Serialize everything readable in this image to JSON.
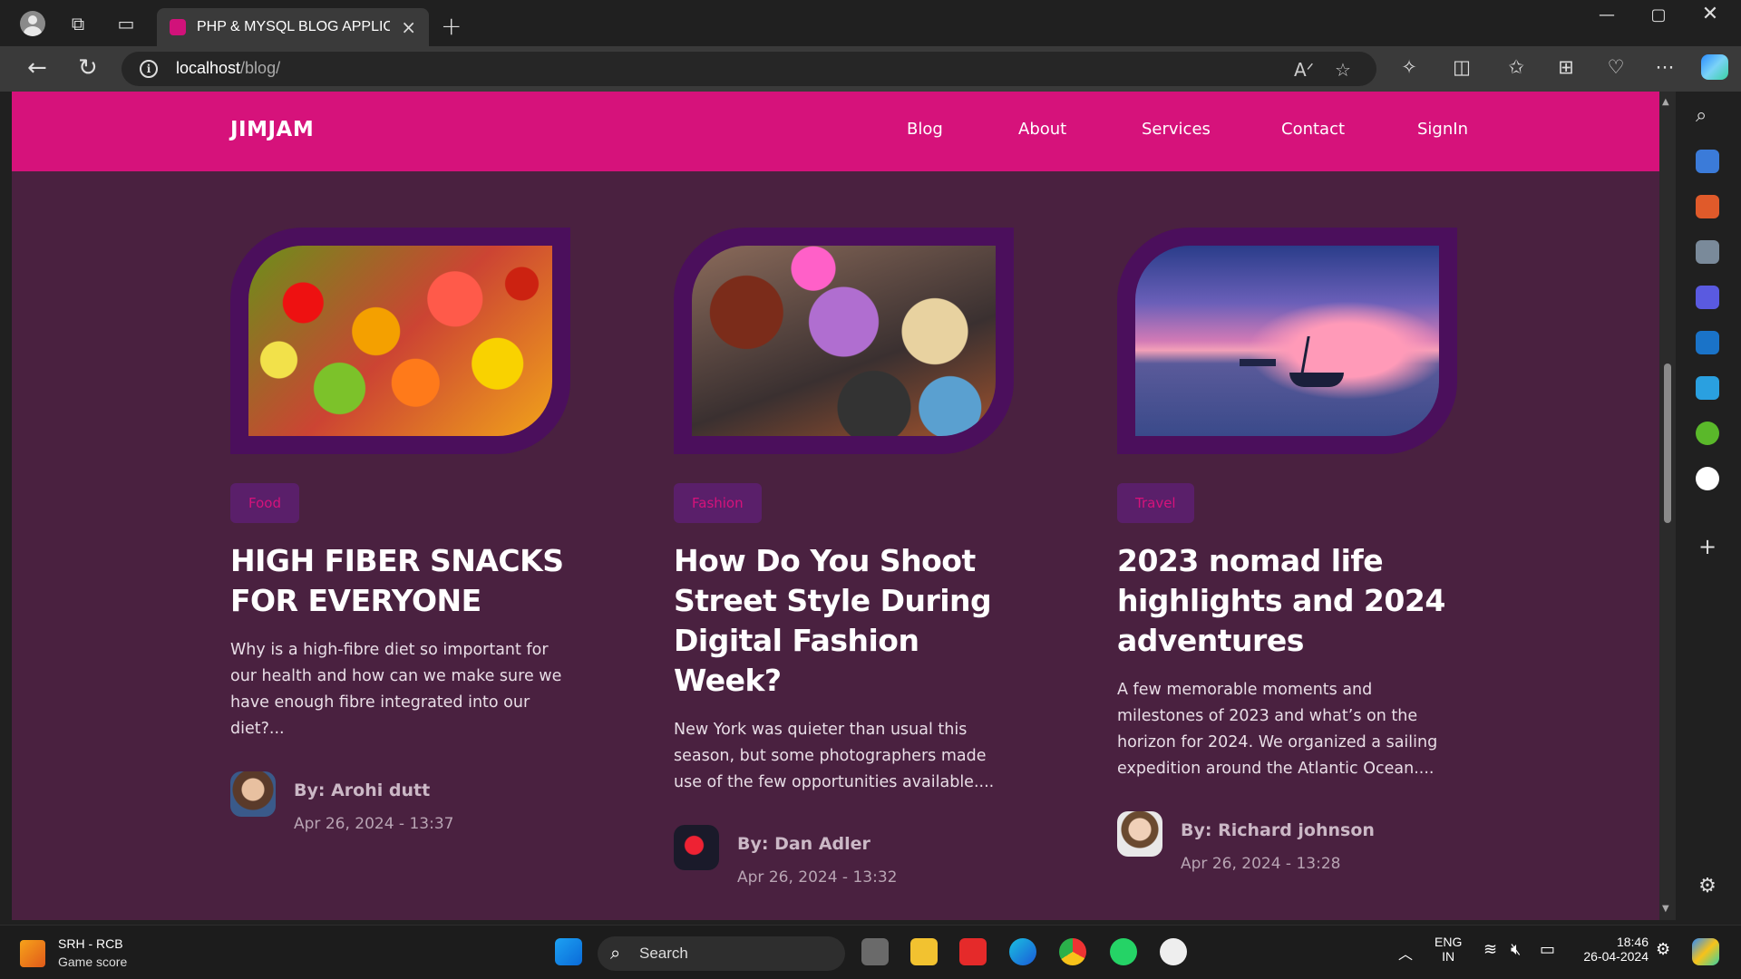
{
  "browser": {
    "tab_title": "PHP & MYSQL BLOG APPLICATIO",
    "url_host": "localhost",
    "url_path": "/blog/"
  },
  "site": {
    "logo": "JIMJAM",
    "nav": [
      "Blog",
      "About",
      "Services",
      "Contact",
      "SignIn"
    ],
    "accent": "#d6127b",
    "background": "#4a2140"
  },
  "posts": [
    {
      "category": "Food",
      "title": "HIGH FIBER SNACKS FOR EVERYONE",
      "excerpt": "Why is a high-fibre diet so important for our health and how can we make sure we have enough fibre integrated into our diet?...",
      "author": "By: Arohi dutt",
      "date": "Apr 26, 2024 - 13:37"
    },
    {
      "category": "Fashion",
      "title": "How Do You Shoot Street Style During Digital Fashion Week?",
      "excerpt": "New York was quieter than usual this season, but some photographers made use of the few opportunities available....",
      "author": "By: Dan Adler",
      "date": "Apr 26, 2024 - 13:32"
    },
    {
      "category": "Travel",
      "title": "2023 nomad life highlights and 2024 adventures",
      "excerpt": "A few memorable moments and milestones of 2023 and what’s on the horizon for 2024. We organized a sailing expedition around the Atlantic Ocean....",
      "author": "By: Richard johnson",
      "date": "Apr 26, 2024 - 13:28"
    }
  ],
  "taskbar": {
    "widget_title": "SRH - RCB",
    "widget_sub": "Game score",
    "search": "Search",
    "lang1": "ENG",
    "lang2": "IN",
    "time": "18:46",
    "date": "26-04-2024"
  }
}
